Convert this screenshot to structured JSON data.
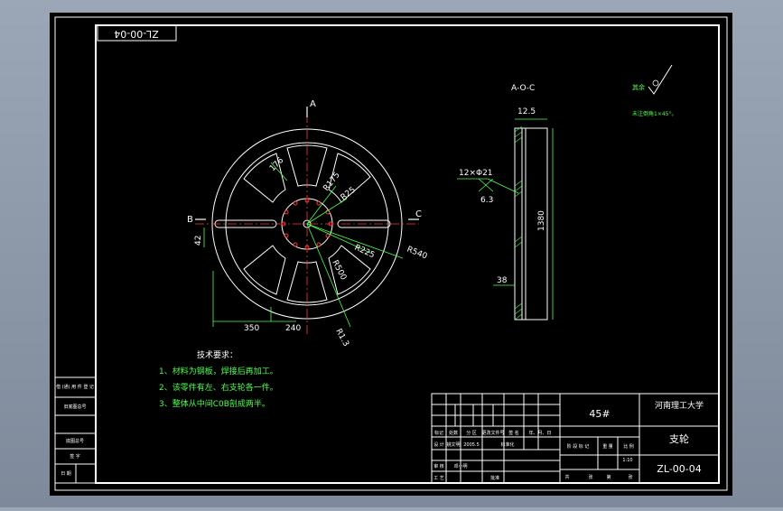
{
  "drawing": {
    "code_stamp": "ZL-00-04",
    "section_views": {
      "view_label": "A-O-C",
      "cut_a": "A",
      "cut_b": "B",
      "cut_c": "C"
    },
    "main_view_dims": {
      "d_176": "176",
      "r175": "R175",
      "r25": "R25",
      "r225": "R225",
      "r540": "R540",
      "r500": "R500",
      "r13": "R1.3",
      "h42": "42",
      "w350": "350",
      "w240": "240"
    },
    "side_view_dims": {
      "top": "12.5",
      "holes": "12×Φ21",
      "h63": "6.3",
      "height": "1380",
      "bottom": "38"
    },
    "roughness": {
      "mark": "其余",
      "note": "未注倒角1×45°。"
    },
    "tech_requirements": {
      "title": "技术要求：",
      "items": [
        "1、材料为钢板，焊接后再加工。",
        "2、该零件有左、右支轮各一件。",
        "3、整体从中间C0B剖成两半。"
      ]
    },
    "title_block": {
      "material": "45#",
      "school": "河南理工大学",
      "part_name": "支轮",
      "drawing_no": "ZL-00-04",
      "scale": "1:10",
      "row_labels": [
        "标记",
        "处数",
        "分 区",
        "更改文件号",
        "签 名",
        "年、月、日"
      ],
      "design_row": [
        "设 计",
        "姚文明",
        "2005.5",
        "标准化"
      ],
      "stage_labels": [
        "阶 段 标 记",
        "重 量",
        "比 例"
      ],
      "check_row": [
        "审 核",
        "邓小明"
      ],
      "process_row": [
        "工 艺",
        "批准"
      ],
      "sheet_row": [
        "共",
        "张",
        "第",
        "张"
      ]
    },
    "left_strip": [
      "借 (通) 用 件 登 记",
      "旧底图总号",
      "底图总号",
      "签 字",
      "日 期"
    ]
  }
}
